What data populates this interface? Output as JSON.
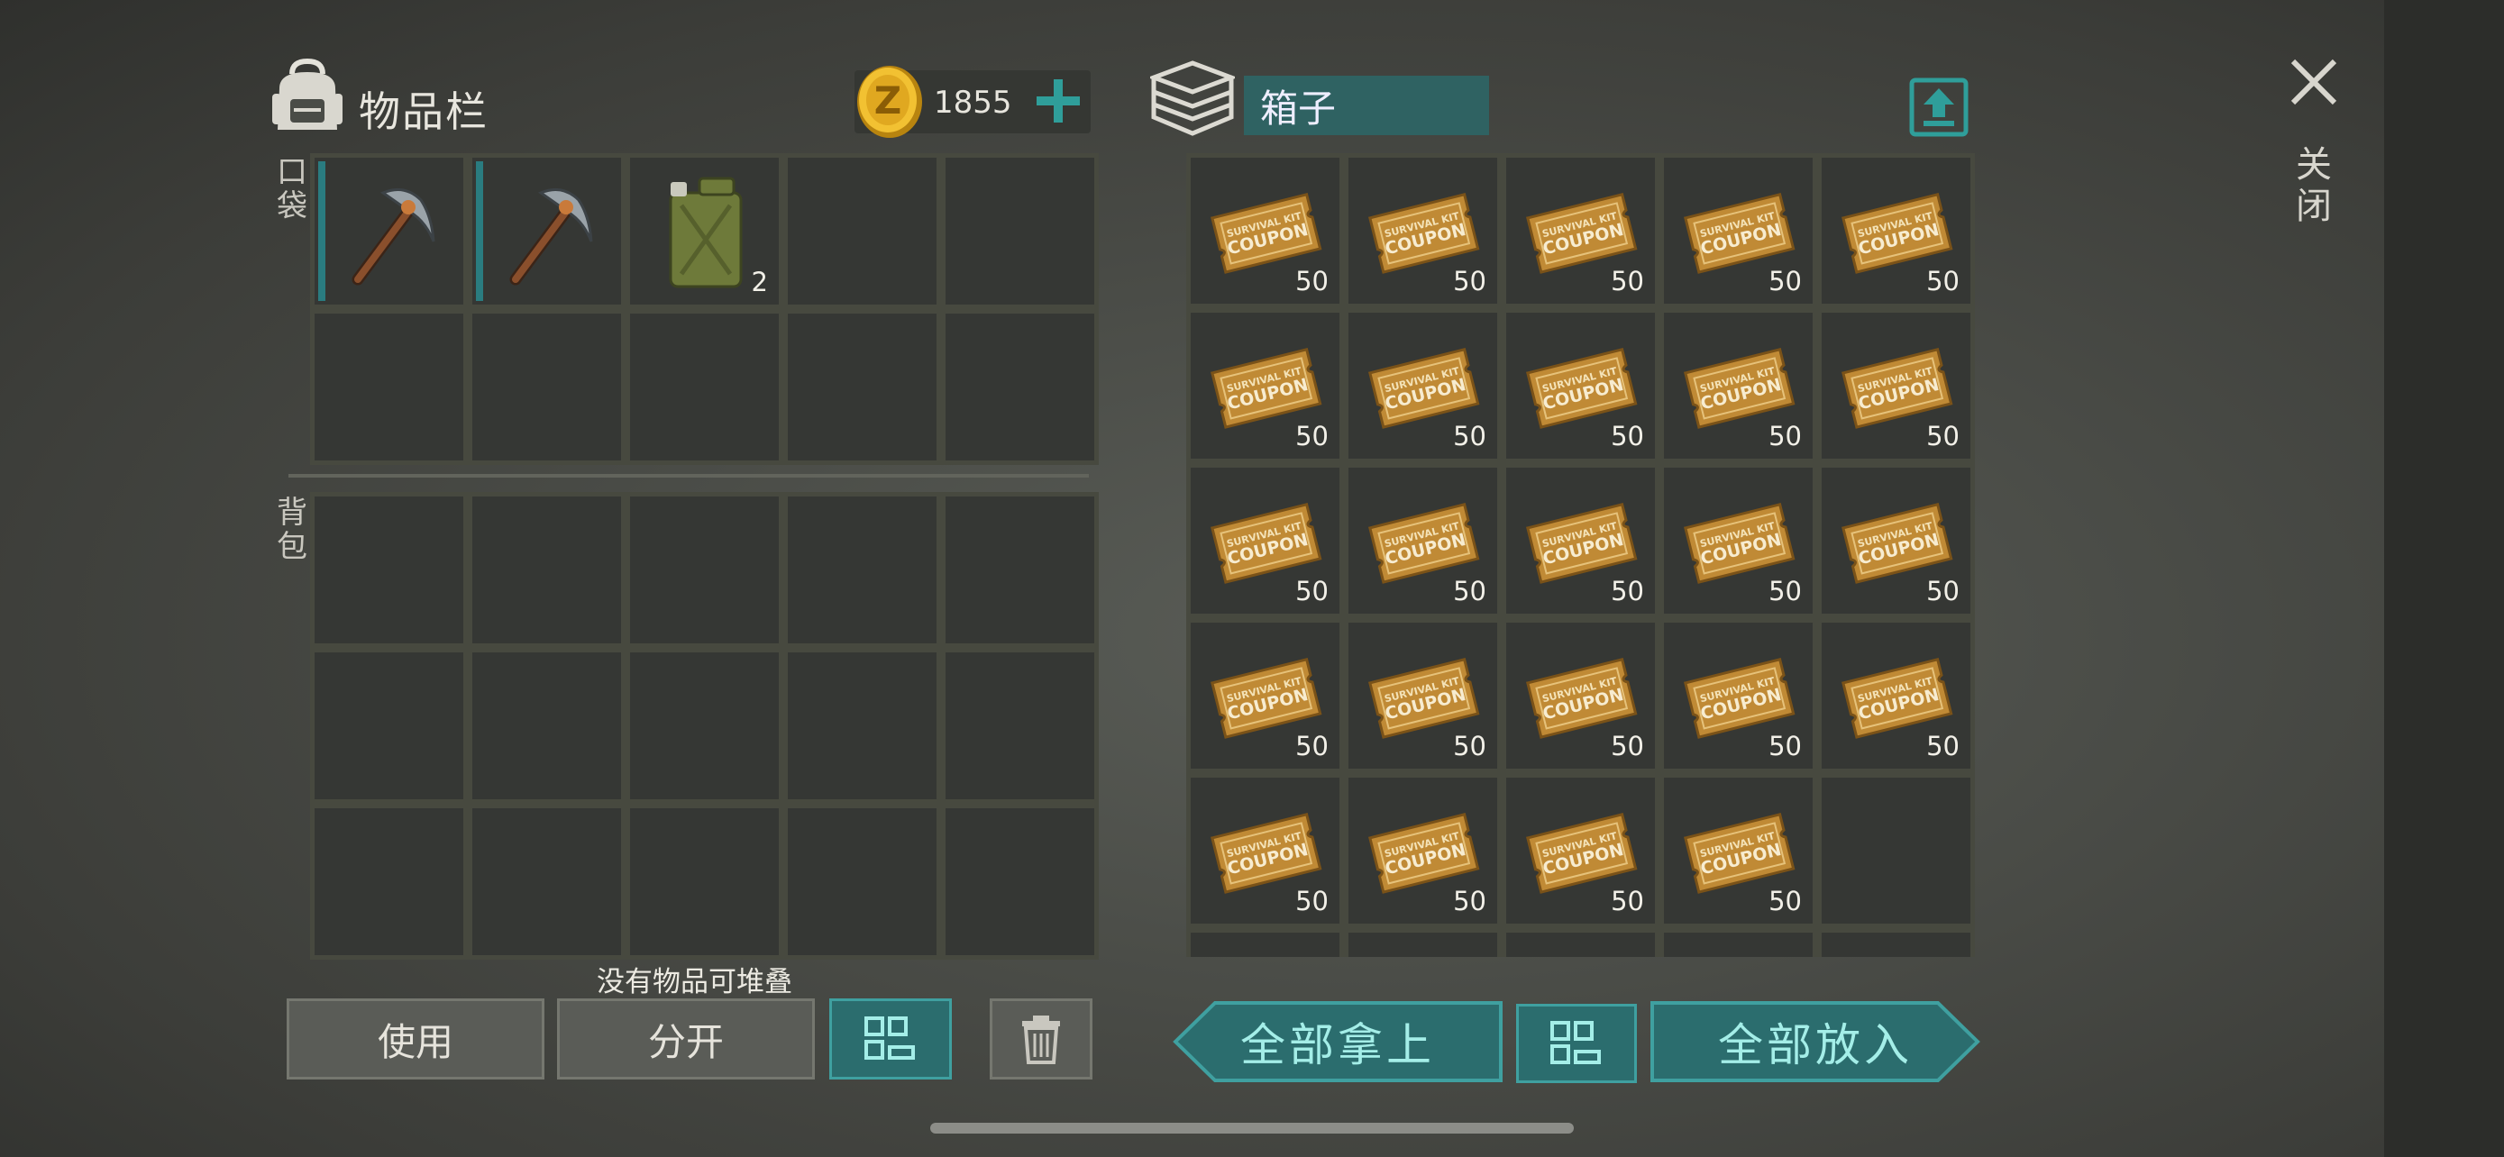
{
  "inventory": {
    "title": "物品栏",
    "pocket_label": "口袋",
    "backpack_label": "背包"
  },
  "currency": {
    "amount": "1855",
    "coin_letter": "Z"
  },
  "container": {
    "name": "箱子"
  },
  "close": {
    "label": "关闭"
  },
  "status": {
    "stack_message": "没有物品可堆叠"
  },
  "buttons": {
    "use": "使用",
    "split": "分开",
    "take_all": "全部拿上",
    "put_all": "全部放入"
  },
  "pocket_slots": [
    {
      "item": "pickaxe-icon",
      "qty": "",
      "equipped": true
    },
    {
      "item": "pickaxe-icon",
      "qty": "",
      "equipped": true
    },
    {
      "item": "fuel-canister-icon",
      "qty": "2",
      "equipped": false
    },
    {
      "item": "",
      "qty": "",
      "equipped": false
    },
    {
      "item": "",
      "qty": "",
      "equipped": false
    },
    {
      "item": "",
      "qty": "",
      "equipped": false
    },
    {
      "item": "",
      "qty": "",
      "equipped": false
    },
    {
      "item": "",
      "qty": "",
      "equipped": false
    },
    {
      "item": "",
      "qty": "",
      "equipped": false
    },
    {
      "item": "",
      "qty": "",
      "equipped": false
    }
  ],
  "backpack_slot_count": 15,
  "box_slots": [
    {
      "item": "coupon-icon",
      "qty": "50"
    },
    {
      "item": "coupon-icon",
      "qty": "50"
    },
    {
      "item": "coupon-icon",
      "qty": "50"
    },
    {
      "item": "coupon-icon",
      "qty": "50"
    },
    {
      "item": "coupon-icon",
      "qty": "50"
    },
    {
      "item": "coupon-icon",
      "qty": "50"
    },
    {
      "item": "coupon-icon",
      "qty": "50"
    },
    {
      "item": "coupon-icon",
      "qty": "50"
    },
    {
      "item": "coupon-icon",
      "qty": "50"
    },
    {
      "item": "coupon-icon",
      "qty": "50"
    },
    {
      "item": "coupon-icon",
      "qty": "50"
    },
    {
      "item": "coupon-icon",
      "qty": "50"
    },
    {
      "item": "coupon-icon",
      "qty": "50"
    },
    {
      "item": "coupon-icon",
      "qty": "50"
    },
    {
      "item": "coupon-icon",
      "qty": "50"
    },
    {
      "item": "coupon-icon",
      "qty": "50"
    },
    {
      "item": "coupon-icon",
      "qty": "50"
    },
    {
      "item": "coupon-icon",
      "qty": "50"
    },
    {
      "item": "coupon-icon",
      "qty": "50"
    },
    {
      "item": "coupon-icon",
      "qty": "50"
    },
    {
      "item": "coupon-icon",
      "qty": "50"
    },
    {
      "item": "coupon-icon",
      "qty": "50"
    },
    {
      "item": "coupon-icon",
      "qty": "50"
    },
    {
      "item": "coupon-icon",
      "qty": "50"
    },
    {
      "item": "",
      "qty": ""
    }
  ],
  "coupon_text": {
    "line1": "SURVIVAL KIT",
    "line2": "COUPON"
  },
  "colors": {
    "accent": "#2b6d6e",
    "accent_text": "#a4eee8",
    "slot": "#353734",
    "slot_border": "#47493f"
  }
}
